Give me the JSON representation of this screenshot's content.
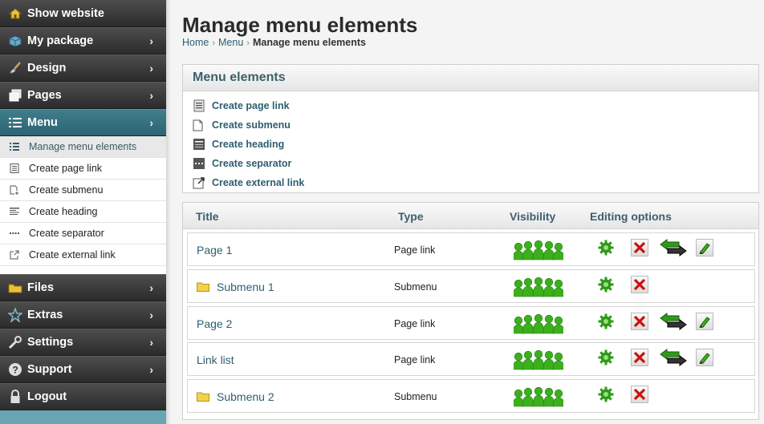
{
  "sidebar": {
    "show_website": "Show website",
    "my_package": "My package",
    "design": "Design",
    "pages": "Pages",
    "menu": "Menu",
    "menu_sub": [
      {
        "label": "Manage menu elements"
      },
      {
        "label": "Create page link"
      },
      {
        "label": "Create submenu"
      },
      {
        "label": "Create heading"
      },
      {
        "label": "Create separator"
      },
      {
        "label": "Create external link"
      }
    ],
    "files": "Files",
    "extras": "Extras",
    "settings": "Settings",
    "support": "Support",
    "logout": "Logout",
    "chevron": "›"
  },
  "header": {
    "title": "Manage menu elements",
    "breadcrumb": {
      "home": "Home",
      "menu": "Menu",
      "current": "Manage menu elements",
      "separator": "›"
    }
  },
  "menu_panel": {
    "title": "Menu elements",
    "links": [
      {
        "label": "Create page link",
        "icon": "page-link-icon"
      },
      {
        "label": "Create submenu",
        "icon": "submenu-icon"
      },
      {
        "label": "Create heading",
        "icon": "heading-icon"
      },
      {
        "label": "Create separator",
        "icon": "separator-icon"
      },
      {
        "label": "Create external link",
        "icon": "external-link-icon"
      }
    ]
  },
  "table": {
    "columns": {
      "title": "Title",
      "type": "Type",
      "visibility": "Visibility",
      "editing": "Editing options"
    },
    "rows": [
      {
        "title": "Page 1",
        "type": "Page link",
        "folder": false,
        "move": true,
        "edit": true
      },
      {
        "title": "Submenu 1",
        "type": "Submenu",
        "folder": true,
        "move": false,
        "edit": false
      },
      {
        "title": "Page 2",
        "type": "Page link",
        "folder": false,
        "move": true,
        "edit": true
      },
      {
        "title": "Link list",
        "type": "Page link",
        "folder": false,
        "move": true,
        "edit": true
      },
      {
        "title": "Submenu 2",
        "type": "Submenu",
        "folder": true,
        "move": false,
        "edit": false
      }
    ]
  },
  "colors": {
    "accent": "#2e5e70",
    "active_nav": "#336d7b",
    "visibility_green": "#3cb01c",
    "delete_red": "#cc1111"
  }
}
